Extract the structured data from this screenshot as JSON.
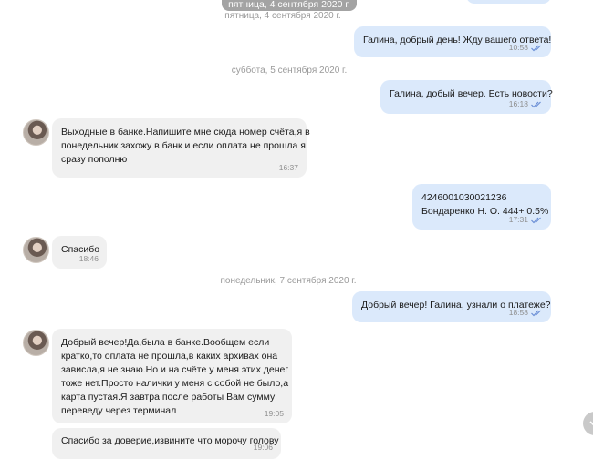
{
  "floating_date": "пятница, 4 сентября 2020 г.",
  "separators": {
    "fri": "пятница, 4 сентября 2020 г.",
    "sat": "суббота, 5 сентября 2020 г.",
    "mon": "понедельник, 7 сентября 2020 г."
  },
  "messages": [
    {
      "dir": "out",
      "text": "Галина, добрый день! Жду вашего ответа!",
      "time": "10:58",
      "read": true
    },
    {
      "dir": "out",
      "text": "Галина, добый вечер. Есть новости?",
      "time": "16:18",
      "read": true
    },
    {
      "dir": "in",
      "text": "Выходные в банке.Напишите мне сюда номер счёта,я в\nпонедельник захожу в банк и если оплата не прошла я\nсразу пополню",
      "time": "16:37"
    },
    {
      "dir": "out",
      "text": "4246001030021236\nБондаренко Н. О. 444+ 0.5%",
      "time": "17:31",
      "read": true
    },
    {
      "dir": "in",
      "text": "Спасибо",
      "time": "18:46"
    },
    {
      "dir": "out",
      "text": "Добрый вечер! Галина, узнали о платеже?",
      "time": "18:58",
      "read": true
    },
    {
      "dir": "in",
      "text": "Добрый вечер!Да,была в банке.Вообщем если\nкратко,то оплата не прошла,в каких архивах она\nзависла,я не знаю.Но и на счёте у меня этих денег\nтоже нет.Просто налички у меня с собой не было,а\nкарта пустая.Я завтра после работы Вам сумму\nпереведу через терминал",
      "time": "19:05"
    },
    {
      "dir": "in",
      "text": "Спасибо за доверие,извините что морочу голову",
      "time": "19:06"
    }
  ],
  "colors": {
    "outgoing": "#dbe9fb",
    "incoming": "#f0f0f0",
    "read_check": "#6b8fd6"
  }
}
